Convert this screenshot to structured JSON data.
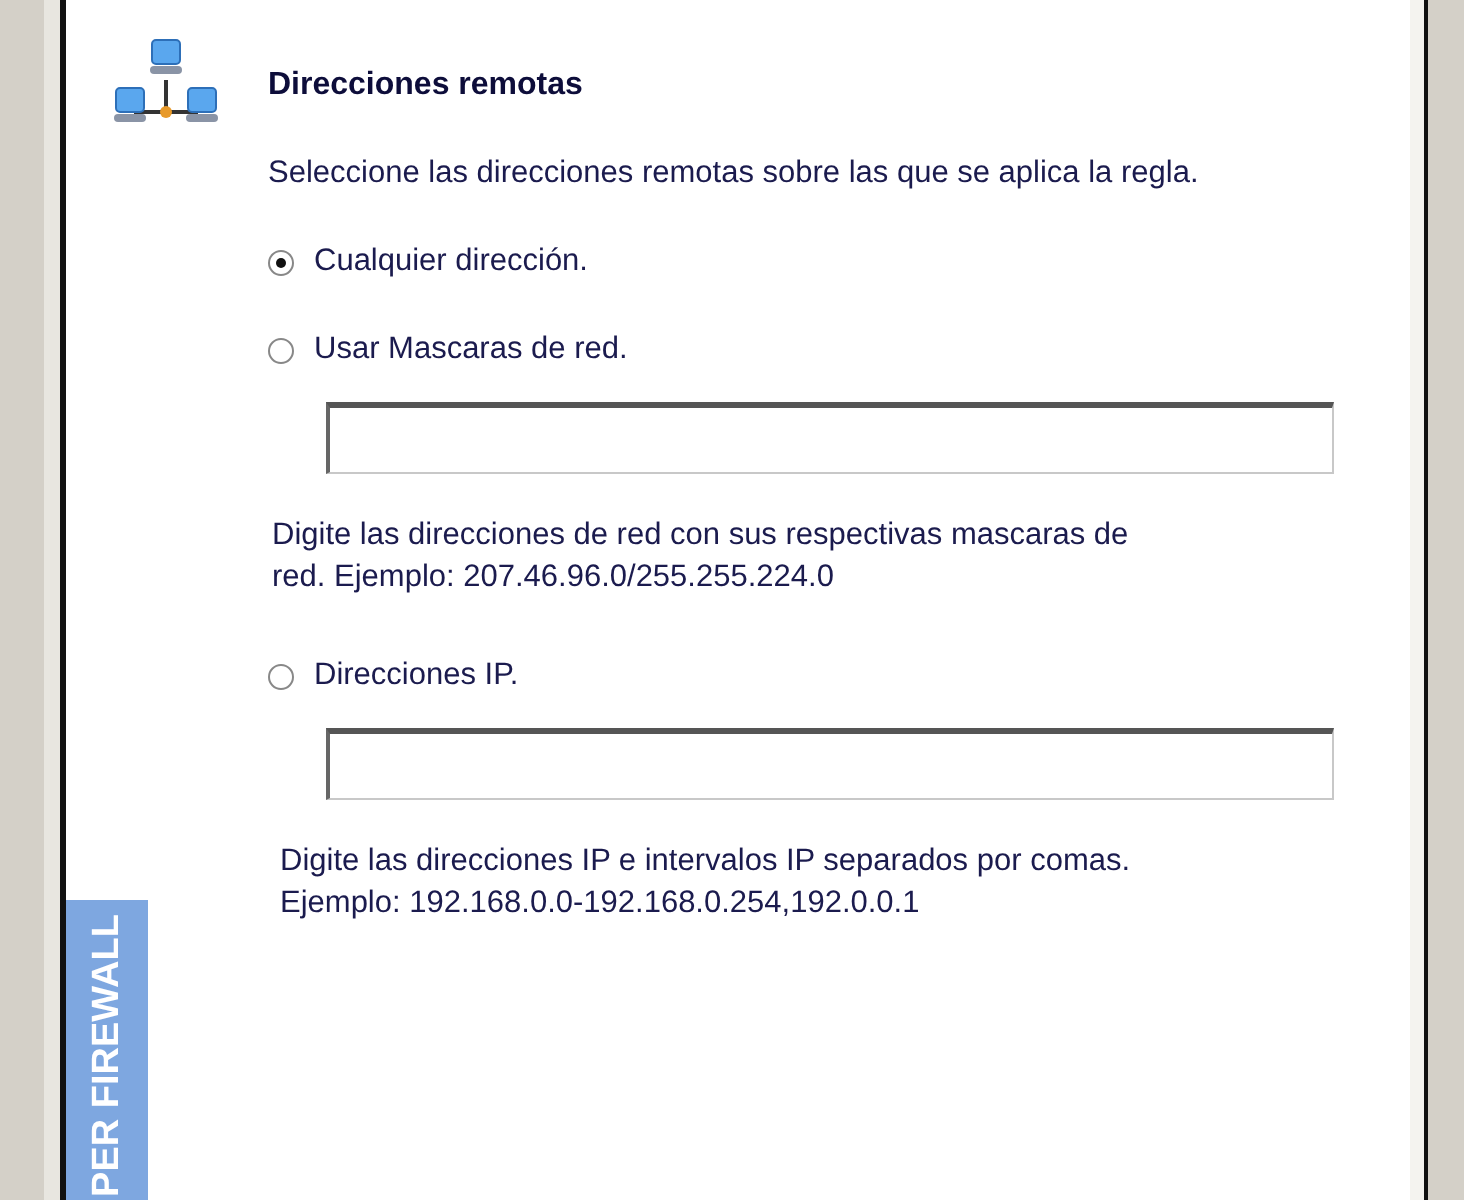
{
  "heading": "Direcciones remotas",
  "instruction": "Seleccione las direcciones remotas sobre las que se aplica la regla.",
  "options": [
    {
      "label": "Cualquier dirección.",
      "selected": true
    },
    {
      "label": "Usar Mascaras de red.",
      "selected": false,
      "has_field": true,
      "hint": [
        "Digite las direcciones de red con sus respectivas mascaras de",
        "red. Ejemplo: 207.46.96.0/255.255.224.0"
      ]
    },
    {
      "label": "Direcciones IP.",
      "selected": false,
      "has_field": true,
      "hint": [
        "Digite las direcciones IP e intervalos IP separados por comas.",
        "Ejemplo: 192.168.0.0-192.168.0.254,192.0.0.1"
      ]
    }
  ],
  "banner": "PER FIREWALL"
}
